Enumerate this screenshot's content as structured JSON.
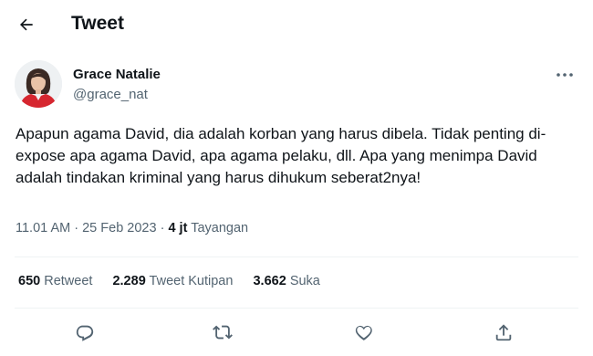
{
  "header": {
    "back_icon": "arrow-left-icon",
    "title": "Tweet"
  },
  "tweet": {
    "author_name": "Grace Natalie",
    "author_handle": "@grace_nat",
    "more_icon": "more-horizontal-icon",
    "text": "Apapun agama David, dia adalah korban yang harus dibela. Tidak penting di-expose apa agama David, apa agama pelaku, dll. Apa yang menimpa David adalah tindakan kriminal yang harus dihukum seberat2nya!",
    "time": "11.01 AM",
    "separator": "·",
    "date": "25 Feb 2023",
    "views_count": "4 jt",
    "views_label": "Tayangan"
  },
  "stats": {
    "retweets_count": "650",
    "retweets_label": "Retweet",
    "quotes_count": "2.289",
    "quotes_label": "Tweet Kutipan",
    "likes_count": "3.662",
    "likes_label": "Suka"
  },
  "actions": {
    "reply_icon": "reply-icon",
    "retweet_icon": "retweet-icon",
    "like_icon": "heart-icon",
    "share_icon": "share-icon"
  },
  "colors": {
    "text_primary": "#0f1419",
    "text_secondary": "#536471",
    "divider": "#eff3f4"
  }
}
